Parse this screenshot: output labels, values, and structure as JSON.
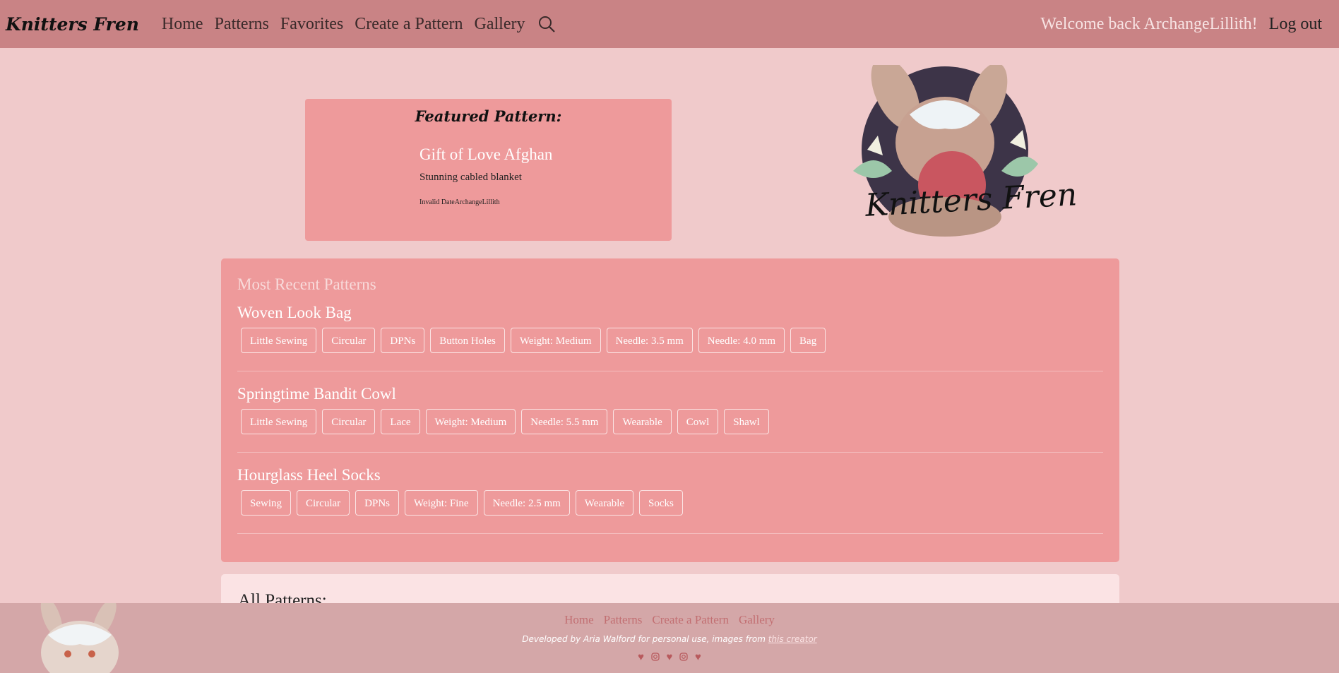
{
  "navbar": {
    "brand": "Knitters Fren",
    "links": [
      "Home",
      "Patterns",
      "Favorites",
      "Create a Pattern",
      "Gallery"
    ],
    "search_icon": "search-icon",
    "welcome": "Welcome back ArchangeLillith!",
    "logout": "Log out"
  },
  "featured": {
    "heading": "Featured Pattern:",
    "title": "Gift of Love Afghan",
    "description": "Stunning cabled blanket",
    "meta": "Invalid DateArchangeLillith"
  },
  "logo": {
    "text": "Knitters Fren"
  },
  "recent": {
    "title": "Most Recent Patterns",
    "patterns": [
      {
        "name": "Woven Look Bag",
        "tags": [
          "Little Sewing",
          "Circular",
          "DPNs",
          "Button Holes",
          "Weight: Medium",
          "Needle: 3.5 mm",
          "Needle: 4.0 mm",
          "Bag"
        ]
      },
      {
        "name": "Springtime Bandit Cowl",
        "tags": [
          "Little Sewing",
          "Circular",
          "Lace",
          "Weight: Medium",
          "Needle: 5.5 mm",
          "Wearable",
          "Cowl",
          "Shawl"
        ]
      },
      {
        "name": "Hourglass Heel Socks",
        "tags": [
          "Sewing",
          "Circular",
          "DPNs",
          "Weight: Fine",
          "Needle: 2.5 mm",
          "Wearable",
          "Socks"
        ]
      }
    ]
  },
  "all_patterns": {
    "title": "All Patterns:"
  },
  "footer": {
    "links": [
      "Home",
      "Patterns",
      "Create a Pattern",
      "Gallery"
    ],
    "credit_prefix": "Developed by Aria Walford for personal use, images from",
    "credit_link": "this creator",
    "icons": [
      "heart-icon",
      "instagram-icon",
      "heart-icon",
      "instagram-icon",
      "heart-icon"
    ]
  },
  "colors": {
    "navbar": "#c98385",
    "page_bg": "#f0cacb",
    "panel": "#ee9a9b",
    "footer": "#d4a7a8"
  }
}
